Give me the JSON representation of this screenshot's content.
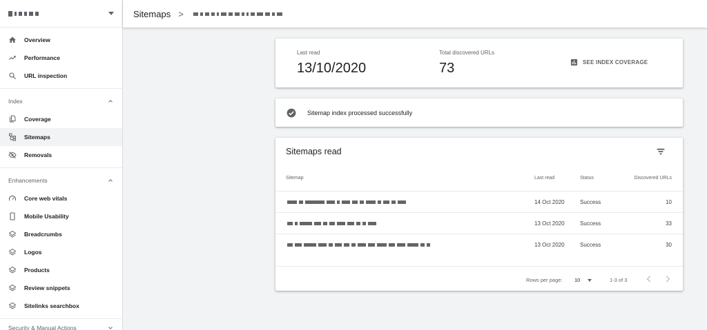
{
  "sidebar": {
    "top_items": [
      {
        "label": "Overview",
        "icon": "home-icon"
      },
      {
        "label": "Performance",
        "icon": "trending-up-icon"
      },
      {
        "label": "URL inspection",
        "icon": "search-icon"
      }
    ],
    "index_group": {
      "header": "Index",
      "items": [
        {
          "label": "Coverage",
          "icon": "file-copy-icon"
        },
        {
          "label": "Sitemaps",
          "icon": "sitemap-icon",
          "active": true
        },
        {
          "label": "Removals",
          "icon": "visibility-off-icon"
        }
      ]
    },
    "enhancements_group": {
      "header": "Enhancements",
      "items": [
        {
          "label": "Core web vitals",
          "icon": "speed-icon"
        },
        {
          "label": "Mobile Usability",
          "icon": "smartphone-icon"
        },
        {
          "label": "Breadcrumbs",
          "icon": "layers-icon"
        },
        {
          "label": "Logos",
          "icon": "layers-icon"
        },
        {
          "label": "Products",
          "icon": "layers-icon"
        },
        {
          "label": "Review snippets",
          "icon": "layers-icon"
        },
        {
          "label": "Sitelinks searchbox",
          "icon": "layers-icon"
        }
      ]
    },
    "security_group": {
      "header": "Security & Manual Actions"
    }
  },
  "header": {
    "title": "Sitemaps",
    "separator": ">"
  },
  "stats": {
    "last_read_label": "Last read",
    "last_read_value": "13/10/2020",
    "discovered_label": "Total discovered URLs",
    "discovered_value": "73",
    "see_coverage": "SEE INDEX COVERAGE"
  },
  "status": {
    "message": "Sitemap index processed successfully"
  },
  "table": {
    "title": "Sitemaps read",
    "columns": [
      "Sitemap",
      "Last read",
      "Status",
      "Discovered URLs"
    ],
    "rows": [
      {
        "last_read": "14 Oct 2020",
        "status": "Success",
        "discovered": "10"
      },
      {
        "last_read": "13 Oct 2020",
        "status": "Success",
        "discovered": "33"
      },
      {
        "last_read": "13 Oct 2020",
        "status": "Success",
        "discovered": "30"
      }
    ],
    "footer": {
      "rows_per_page_label": "Rows per page:",
      "rows_per_page_value": "10",
      "range": "1-3 of 3"
    }
  },
  "colors": {
    "sidebar_active": "#f1f3f4",
    "page_bg": "#f1f3f4",
    "text_primary": "#202124",
    "text_secondary": "#5f6368"
  }
}
